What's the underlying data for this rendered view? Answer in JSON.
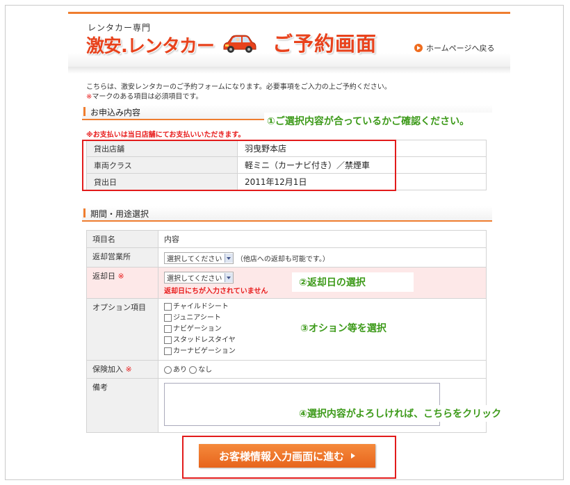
{
  "header": {
    "brand_sub": "レンタカー専門",
    "brand": "激安.レンタカー",
    "page_title": "ご予約画面",
    "home_link": "ホームページへ戻る"
  },
  "intro": {
    "line1": "こちらは、激安レンタカーのご予約フォームになります。必要事項をご入力の上ご予約ください。",
    "req_mark": "※",
    "line2_rest": "マークのある項目は必須項目です。"
  },
  "section1": {
    "title": "お申込み内容",
    "pay_note": "※お支払いは当日店舗にてお支払いいただきます。",
    "rows": [
      {
        "label": "貸出店舗",
        "value": "羽曳野本店"
      },
      {
        "label": "車両クラス",
        "value": "軽ミニ（カーナビ付き）／禁煙車"
      },
      {
        "label": "貸出日",
        "value": "2011年12月1日"
      }
    ]
  },
  "section2": {
    "title": "期間・用途選択",
    "col_item": "項目名",
    "col_content": "内容",
    "return_office": {
      "label": "返却営業所",
      "select": "選択してください",
      "note": "（他店への返却も可能です。）"
    },
    "return_date": {
      "label": "返却日",
      "req": "※",
      "select": "選択してください",
      "error": "返却日にちが入力されていません"
    },
    "options": {
      "label": "オプション項目",
      "items": [
        "チャイルドシート",
        "ジュニアシート",
        "ナビゲーション",
        "スタッドレスタイヤ",
        "カーナビゲーション"
      ]
    },
    "insurance": {
      "label": "保険加入",
      "req": "※",
      "yes": "あり",
      "no": "なし"
    },
    "remarks": {
      "label": "備考"
    }
  },
  "annotations": {
    "a1": "①ご選択内容が合っているかご確認ください。",
    "a2": "②返却日の選択",
    "a3": "③オション等を選択",
    "a4": "④選択内容がよろしければ、こちらをクリック"
  },
  "submit": {
    "label": "お客様情報入力画面に進む"
  },
  "colors": {
    "accent": "#ef7d2f",
    "brand_red": "#e8421c",
    "annotation_green": "#3d9a1a",
    "highlight_red": "#e21b1b"
  }
}
